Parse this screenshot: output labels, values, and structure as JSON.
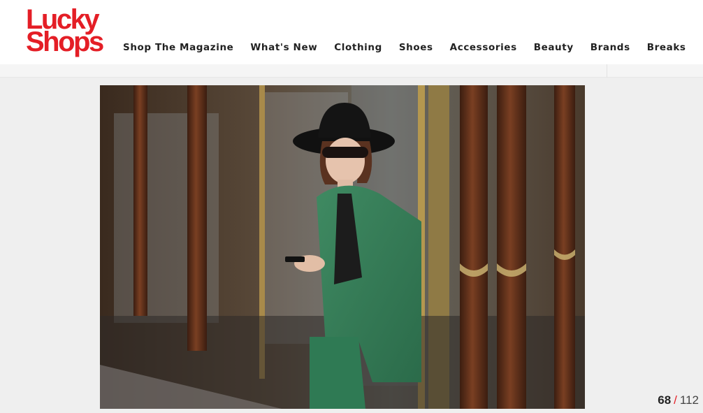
{
  "logo": {
    "line1": "Lucky",
    "line2": "Shops",
    "color": "#e41e26"
  },
  "nav": {
    "items": [
      {
        "label": "Shop The Magazine"
      },
      {
        "label": "What's New"
      },
      {
        "label": "Clothing"
      },
      {
        "label": "Shoes"
      },
      {
        "label": "Accessories"
      },
      {
        "label": "Beauty"
      },
      {
        "label": "Brands"
      },
      {
        "label": "Breaks"
      }
    ]
  },
  "slideshow": {
    "current": "68",
    "separator": "/",
    "total": "112"
  }
}
